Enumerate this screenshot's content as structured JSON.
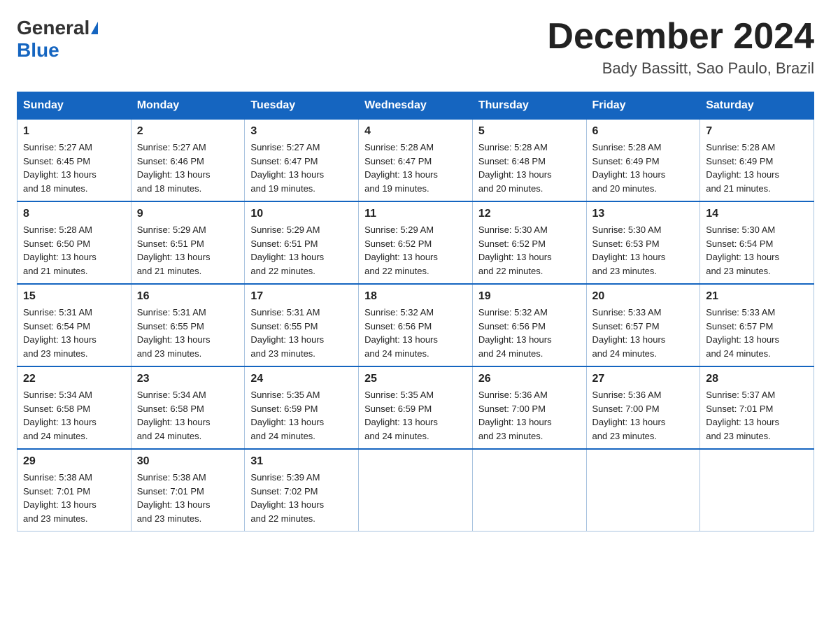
{
  "header": {
    "logo_general": "General",
    "logo_blue": "Blue",
    "title": "December 2024",
    "location": "Bady Bassitt, Sao Paulo, Brazil"
  },
  "days_of_week": [
    "Sunday",
    "Monday",
    "Tuesday",
    "Wednesday",
    "Thursday",
    "Friday",
    "Saturday"
  ],
  "weeks": [
    [
      {
        "day": "1",
        "sunrise": "5:27 AM",
        "sunset": "6:45 PM",
        "daylight": "13 hours and 18 minutes."
      },
      {
        "day": "2",
        "sunrise": "5:27 AM",
        "sunset": "6:46 PM",
        "daylight": "13 hours and 18 minutes."
      },
      {
        "day": "3",
        "sunrise": "5:27 AM",
        "sunset": "6:47 PM",
        "daylight": "13 hours and 19 minutes."
      },
      {
        "day": "4",
        "sunrise": "5:28 AM",
        "sunset": "6:47 PM",
        "daylight": "13 hours and 19 minutes."
      },
      {
        "day": "5",
        "sunrise": "5:28 AM",
        "sunset": "6:48 PM",
        "daylight": "13 hours and 20 minutes."
      },
      {
        "day": "6",
        "sunrise": "5:28 AM",
        "sunset": "6:49 PM",
        "daylight": "13 hours and 20 minutes."
      },
      {
        "day": "7",
        "sunrise": "5:28 AM",
        "sunset": "6:49 PM",
        "daylight": "13 hours and 21 minutes."
      }
    ],
    [
      {
        "day": "8",
        "sunrise": "5:28 AM",
        "sunset": "6:50 PM",
        "daylight": "13 hours and 21 minutes."
      },
      {
        "day": "9",
        "sunrise": "5:29 AM",
        "sunset": "6:51 PM",
        "daylight": "13 hours and 21 minutes."
      },
      {
        "day": "10",
        "sunrise": "5:29 AM",
        "sunset": "6:51 PM",
        "daylight": "13 hours and 22 minutes."
      },
      {
        "day": "11",
        "sunrise": "5:29 AM",
        "sunset": "6:52 PM",
        "daylight": "13 hours and 22 minutes."
      },
      {
        "day": "12",
        "sunrise": "5:30 AM",
        "sunset": "6:52 PM",
        "daylight": "13 hours and 22 minutes."
      },
      {
        "day": "13",
        "sunrise": "5:30 AM",
        "sunset": "6:53 PM",
        "daylight": "13 hours and 23 minutes."
      },
      {
        "day": "14",
        "sunrise": "5:30 AM",
        "sunset": "6:54 PM",
        "daylight": "13 hours and 23 minutes."
      }
    ],
    [
      {
        "day": "15",
        "sunrise": "5:31 AM",
        "sunset": "6:54 PM",
        "daylight": "13 hours and 23 minutes."
      },
      {
        "day": "16",
        "sunrise": "5:31 AM",
        "sunset": "6:55 PM",
        "daylight": "13 hours and 23 minutes."
      },
      {
        "day": "17",
        "sunrise": "5:31 AM",
        "sunset": "6:55 PM",
        "daylight": "13 hours and 23 minutes."
      },
      {
        "day": "18",
        "sunrise": "5:32 AM",
        "sunset": "6:56 PM",
        "daylight": "13 hours and 24 minutes."
      },
      {
        "day": "19",
        "sunrise": "5:32 AM",
        "sunset": "6:56 PM",
        "daylight": "13 hours and 24 minutes."
      },
      {
        "day": "20",
        "sunrise": "5:33 AM",
        "sunset": "6:57 PM",
        "daylight": "13 hours and 24 minutes."
      },
      {
        "day": "21",
        "sunrise": "5:33 AM",
        "sunset": "6:57 PM",
        "daylight": "13 hours and 24 minutes."
      }
    ],
    [
      {
        "day": "22",
        "sunrise": "5:34 AM",
        "sunset": "6:58 PM",
        "daylight": "13 hours and 24 minutes."
      },
      {
        "day": "23",
        "sunrise": "5:34 AM",
        "sunset": "6:58 PM",
        "daylight": "13 hours and 24 minutes."
      },
      {
        "day": "24",
        "sunrise": "5:35 AM",
        "sunset": "6:59 PM",
        "daylight": "13 hours and 24 minutes."
      },
      {
        "day": "25",
        "sunrise": "5:35 AM",
        "sunset": "6:59 PM",
        "daylight": "13 hours and 24 minutes."
      },
      {
        "day": "26",
        "sunrise": "5:36 AM",
        "sunset": "7:00 PM",
        "daylight": "13 hours and 23 minutes."
      },
      {
        "day": "27",
        "sunrise": "5:36 AM",
        "sunset": "7:00 PM",
        "daylight": "13 hours and 23 minutes."
      },
      {
        "day": "28",
        "sunrise": "5:37 AM",
        "sunset": "7:01 PM",
        "daylight": "13 hours and 23 minutes."
      }
    ],
    [
      {
        "day": "29",
        "sunrise": "5:38 AM",
        "sunset": "7:01 PM",
        "daylight": "13 hours and 23 minutes."
      },
      {
        "day": "30",
        "sunrise": "5:38 AM",
        "sunset": "7:01 PM",
        "daylight": "13 hours and 23 minutes."
      },
      {
        "day": "31",
        "sunrise": "5:39 AM",
        "sunset": "7:02 PM",
        "daylight": "13 hours and 22 minutes."
      },
      null,
      null,
      null,
      null
    ]
  ],
  "labels": {
    "sunrise_prefix": "Sunrise: ",
    "sunset_prefix": "Sunset: ",
    "daylight_prefix": "Daylight: "
  }
}
